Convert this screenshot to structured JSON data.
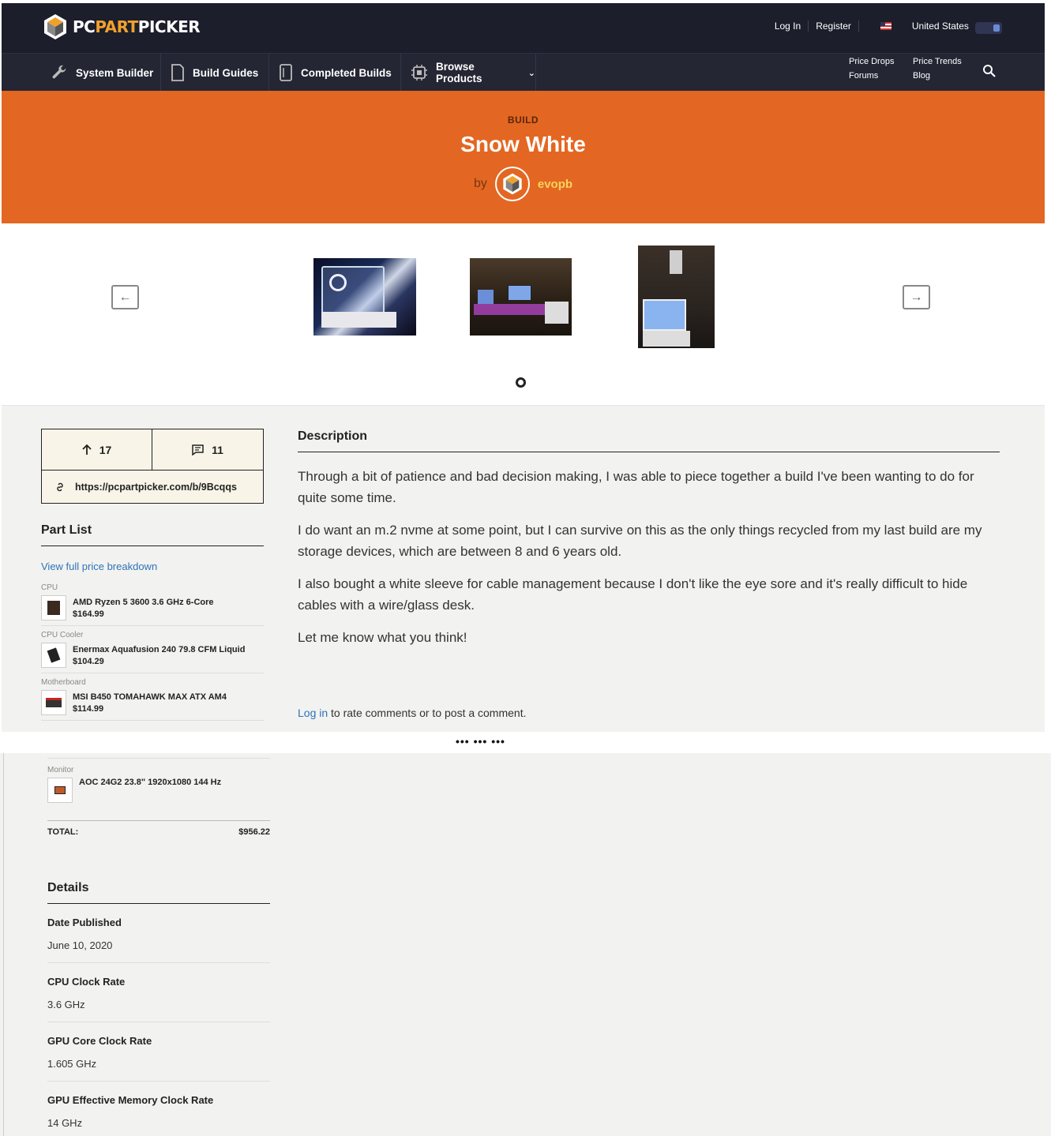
{
  "header": {
    "logo": {
      "part1": "PC",
      "part2": "PART",
      "part3": "PICKER"
    },
    "login": "Log In",
    "register": "Register",
    "country": "United States"
  },
  "nav": {
    "items": [
      "System Builder",
      "Build Guides",
      "Completed Builds",
      "Browse Products"
    ],
    "right": [
      "Price Drops",
      "Price Trends",
      "Forums",
      "Blog"
    ]
  },
  "hero": {
    "kicker": "BUILD",
    "title": "Snow White",
    "by": "by",
    "author": "evopb"
  },
  "stats": {
    "upvotes": "17",
    "comments": "11",
    "link": "https://pcpartpicker.com/b/9Bcqqs"
  },
  "partlist": {
    "title": "Part List",
    "view_full": "View full price breakdown",
    "parts": [
      {
        "type": "CPU",
        "name": "AMD Ryzen 5 3600 3.6 GHz 6-Core",
        "price": "$164.99"
      },
      {
        "type": "CPU Cooler",
        "name": "Enermax Aquafusion 240 79.8 CFM Liquid",
        "price": "$104.29"
      },
      {
        "type": "Motherboard",
        "name": "MSI B450 TOMAHAWK MAX ATX AM4",
        "price": "$114.99"
      }
    ],
    "monitor": {
      "type": "Monitor",
      "name": "AOC 24G2 23.8\" 1920x1080 144 Hz"
    },
    "total_label": "TOTAL:",
    "total_value": "$956.22"
  },
  "description": {
    "title": "Description",
    "paragraphs": [
      "Through a bit of patience and bad decision making, I was able to piece together a build I've been wanting to do for quite some time.",
      "I do want an m.2 nvme at some point, but I can survive on this as the only things recycled from my last build are my storage devices, which are between 8 and 6 years old.",
      "I also bought a white sleeve for cable management because I don't like the eye sore and it's really difficult to hide cables with a wire/glass desk.",
      "Let me know what you think!"
    ],
    "login_link": "Log in",
    "comment_text": " to rate comments or to post a comment."
  },
  "separator": "••• ••• •••",
  "details": {
    "title": "Details",
    "rows": [
      {
        "label": "Date Published",
        "value": "June 10, 2020"
      },
      {
        "label": "CPU Clock Rate",
        "value": "3.6 GHz"
      },
      {
        "label": "GPU Core Clock Rate",
        "value": "1.605 GHz"
      },
      {
        "label": "GPU Effective Memory Clock Rate",
        "value": "14 GHz"
      }
    ]
  },
  "colors": {
    "hero": "#e36722",
    "nav": "#1c1e2b",
    "author": "#f7d45c",
    "link": "#2f73b9"
  }
}
